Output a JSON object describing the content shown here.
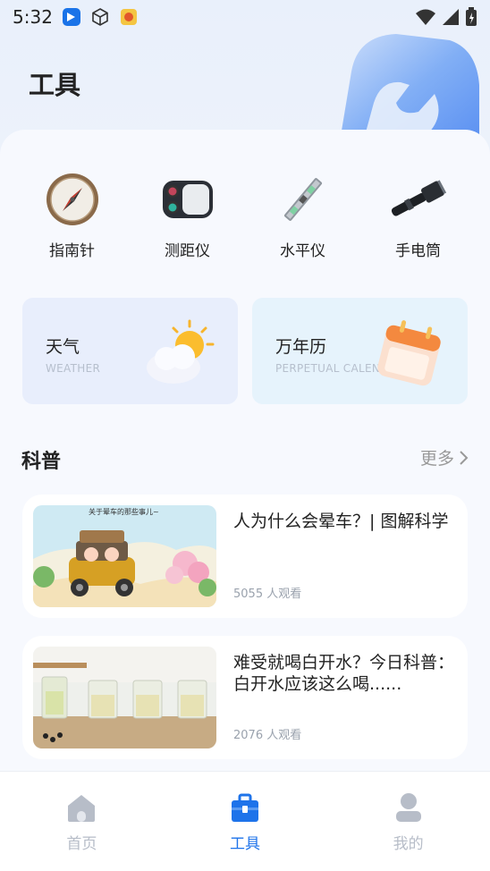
{
  "status_bar": {
    "time": "5:32"
  },
  "page": {
    "title": "工具"
  },
  "tools": [
    {
      "label": "指南针",
      "icon": "compass-icon"
    },
    {
      "label": "测距仪",
      "icon": "rangefinder-icon"
    },
    {
      "label": "水平仪",
      "icon": "spirit-level-icon"
    },
    {
      "label": "手电筒",
      "icon": "flashlight-icon"
    }
  ],
  "cards": {
    "weather": {
      "title": "天气",
      "subtitle": "WEATHER"
    },
    "calendar": {
      "title": "万年历",
      "subtitle": "PERPETUAL CALENDAR"
    }
  },
  "science": {
    "title": "科普",
    "more": "更多",
    "articles": [
      {
        "title": "人为什么会晕车？| 图解科学",
        "views": "5055 人观看",
        "thumb_caption": "关于晕车的那些事儿~"
      },
      {
        "title": "难受就喝白开水？今日科普：白开水应该这么喝......",
        "views": "2076 人观看"
      }
    ]
  },
  "tabbar": {
    "home": "首页",
    "tools": "工具",
    "mine": "我的"
  },
  "colors": {
    "accent": "#1e73ea",
    "inactive": "#b7bdc8"
  }
}
